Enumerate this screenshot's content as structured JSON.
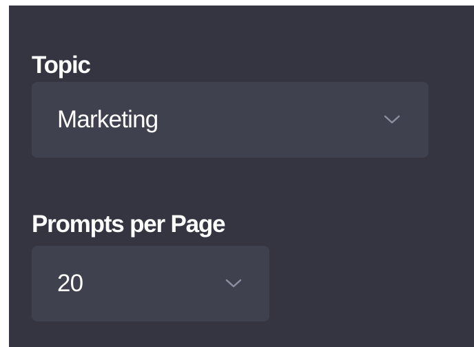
{
  "topic": {
    "label": "Topic",
    "selected": "Marketing",
    "icon": "chevron-down-icon"
  },
  "prompts_per_page": {
    "label": "Prompts per Page",
    "selected": "20",
    "icon": "chevron-down-icon"
  },
  "colors": {
    "panel_background": "#343541",
    "select_background": "#40414f",
    "text": "#ffffff",
    "chevron": "#8e8ea0"
  }
}
